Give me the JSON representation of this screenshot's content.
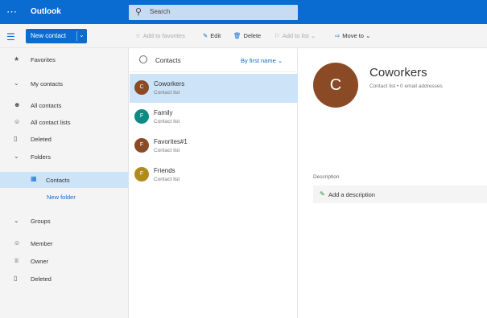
{
  "app": {
    "name": "Outlook"
  },
  "search": {
    "placeholder": "Search"
  },
  "toolbar": {
    "new_contact": "New contact",
    "add_to_favorites": "Add to favorites",
    "edit": "Edit",
    "delete": "Delete",
    "add_to_list": "Add to list",
    "move_to": "Move to"
  },
  "sidebar": {
    "favorites": "Favorites",
    "my_contacts": "My contacts",
    "all_contacts": "All contacts",
    "all_contact_lists": "All contact lists",
    "deleted": "Deleted",
    "folders": "Folders",
    "contacts_folder": "Contacts",
    "new_folder": "New folder",
    "groups": "Groups",
    "member": "Member",
    "owner": "Owner",
    "groups_deleted": "Deleted"
  },
  "list": {
    "header": "Contacts",
    "sort": "By first name",
    "items": [
      {
        "initial": "C",
        "name": "Coworkers",
        "subtitle": "Contact list",
        "color": "#8a4a25"
      },
      {
        "initial": "F",
        "name": "Family",
        "subtitle": "Contact list",
        "color": "#0e8a84"
      },
      {
        "initial": "F",
        "name": "Favorites#1",
        "subtitle": "Contact list",
        "color": "#8a4a25"
      },
      {
        "initial": "F",
        "name": "Friends",
        "subtitle": "Contact list",
        "color": "#b08a1a"
      }
    ]
  },
  "detail": {
    "initial": "C",
    "title": "Coworkers",
    "subtitle": "Contact list • 0 email addresses",
    "description_label": "Description",
    "add_description": "Add a description"
  },
  "colors": {
    "accent": "#0a6cd0",
    "selected": "#cde3f8"
  }
}
